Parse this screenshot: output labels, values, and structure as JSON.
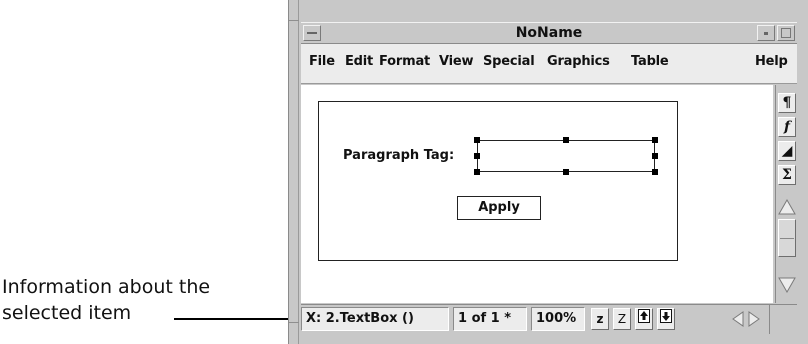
{
  "annotation": {
    "text": "Information about the selected item"
  },
  "window": {
    "title": "NoName",
    "menu": [
      "File",
      "Edit",
      "Format",
      "View",
      "Special",
      "Graphics",
      "Table",
      "Help"
    ]
  },
  "panel": {
    "paragraph_label": "Paragraph Tag:",
    "paragraph_value": "",
    "apply_label": "Apply"
  },
  "toolbar": {
    "paragraph_icon": "¶",
    "function_icon": "f",
    "triangle_icon": "◢",
    "sigma_icon": "Σ"
  },
  "status": {
    "selected_item": "X:  2.TextBox ()",
    "page": "1 of 1 *",
    "zoom": "100%",
    "z_label": "z",
    "z_shape_label": "Z"
  }
}
